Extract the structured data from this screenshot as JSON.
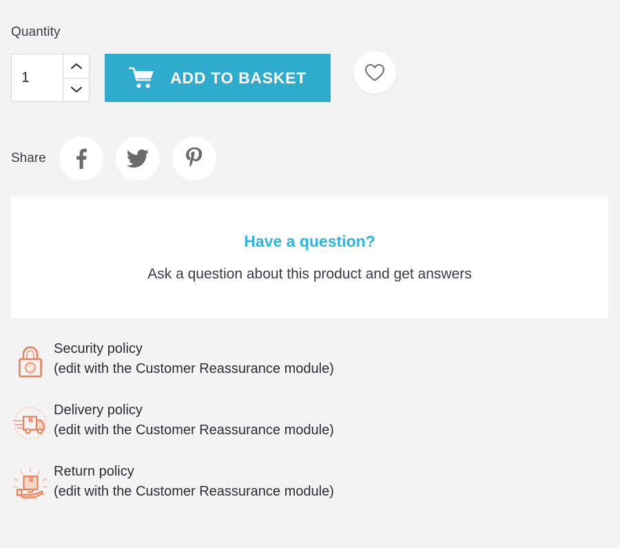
{
  "quantity": {
    "label": "Quantity",
    "value": "1",
    "placeholder": "1",
    "increase_title": "Increase quantity",
    "decrease_title": "Decrease quantity"
  },
  "actions": {
    "add_to_basket_label": "ADD TO BASKET",
    "add_to_basket_color": "#2fabcd",
    "wishlist_title": "Add to wishlist"
  },
  "share": {
    "label": "Share",
    "networks": [
      {
        "name": "Facebook",
        "icon": "facebook-icon"
      },
      {
        "name": "Twitter",
        "icon": "twitter-icon"
      },
      {
        "name": "Pinterest",
        "icon": "pinterest-icon"
      }
    ]
  },
  "question_card": {
    "title": "Have a question?",
    "title_color": "#2fb5dc",
    "subtitle": "Ask a question about this product and get answers"
  },
  "policies": [
    {
      "icon": "padlock-icon",
      "title": "Security policy",
      "description": "(edit with the Customer Reassurance module)"
    },
    {
      "icon": "delivery-truck-icon",
      "title": "Delivery policy",
      "description": "(edit with the Customer Reassurance module)"
    },
    {
      "icon": "return-box-hand-icon",
      "title": "Return policy",
      "description": "(edit with the Customer Reassurance module)"
    }
  ],
  "theme": {
    "page_background": "#f3f3f3",
    "card_background": "#ffffff",
    "accent": "#2fabcd",
    "policy_icon_color": "#e8825d",
    "text": "#2b2b35"
  }
}
